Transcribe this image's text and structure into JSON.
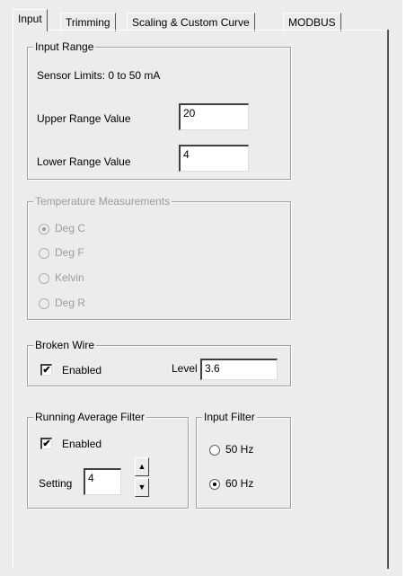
{
  "tabs": [
    {
      "label": "Input",
      "active": true
    },
    {
      "label": "Trimming",
      "active": false
    },
    {
      "label": "Scaling & Custom Curve",
      "active": false
    },
    {
      "label": "MODBUS",
      "active": false
    }
  ],
  "input_range": {
    "title": "Input Range",
    "sensor_limits": "Sensor Limits:  0 to 50 mA",
    "upper_label": "Upper Range Value",
    "upper_value": "20",
    "lower_label": "Lower Range Value",
    "lower_value": "4"
  },
  "temperature": {
    "title": "Temperature Measurements",
    "options": [
      {
        "label": "Deg C",
        "selected": true
      },
      {
        "label": "Deg F",
        "selected": false
      },
      {
        "label": "Kelvin",
        "selected": false
      },
      {
        "label": "Deg R",
        "selected": false
      }
    ]
  },
  "broken_wire": {
    "title": "Broken Wire",
    "enabled_label": "Enabled",
    "enabled_checked": true,
    "level_label": "Level",
    "level_value": "3.6"
  },
  "running_average": {
    "title": "Running Average Filter",
    "enabled_label": "Enabled",
    "enabled_checked": true,
    "setting_label": "Setting",
    "setting_value": "4"
  },
  "input_filter": {
    "title": "Input Filter",
    "options": [
      {
        "label": "50 Hz",
        "selected": false
      },
      {
        "label": "60 Hz",
        "selected": true
      }
    ]
  },
  "glyphs": {
    "check": "✔",
    "up": "▲",
    "down": "▼"
  }
}
